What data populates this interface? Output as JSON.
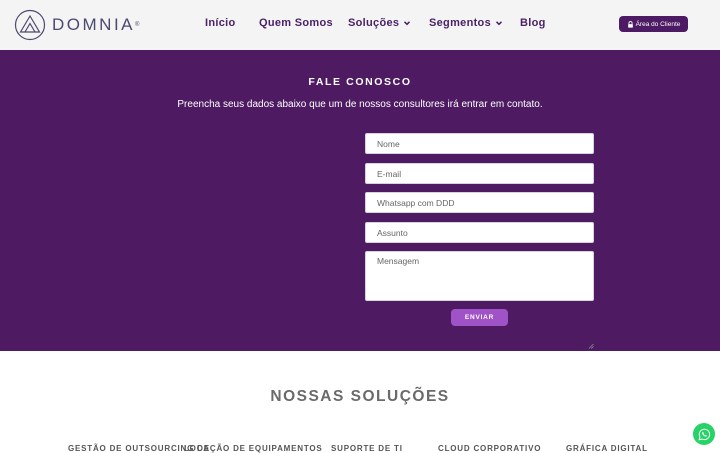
{
  "header": {
    "brand": "DOMNIA",
    "brand_mark": "®",
    "nav": [
      {
        "label": "Início"
      },
      {
        "label": "Quem Somos"
      },
      {
        "label": "Soluções"
      },
      {
        "label": "Segmentos"
      },
      {
        "label": "Blog"
      }
    ],
    "client_area_label": "Área do Cliente",
    "client_area_icon": "lock-icon"
  },
  "contact": {
    "title": "FALE CONOSCO",
    "subtitle": "Preencha seus dados abaixo que um de nossos consultores irá entrar em contato.",
    "fields": {
      "name_placeholder": "Nome",
      "email_placeholder": "E-mail",
      "whatsapp_placeholder": "Whatsapp com DDD",
      "subject_placeholder": "Assunto",
      "message_placeholder": "Mensagem"
    },
    "submit_label": "ENVIAR"
  },
  "solutions": {
    "title": "NOSSAS SOLUÇÕES",
    "items": [
      {
        "label": "GESTÃO DE OUTSOURCING DE"
      },
      {
        "label": "LOCAÇÃO DE EQUIPAMENTOS"
      },
      {
        "label": "SUPORTE DE TI"
      },
      {
        "label": "CLOUD CORPORATIVO"
      },
      {
        "label": "GRÁFICA DIGITAL"
      }
    ]
  },
  "colors": {
    "brand_purple": "#4e1b62",
    "accent_purple": "#a052c7",
    "whatsapp_green": "#25d366"
  }
}
